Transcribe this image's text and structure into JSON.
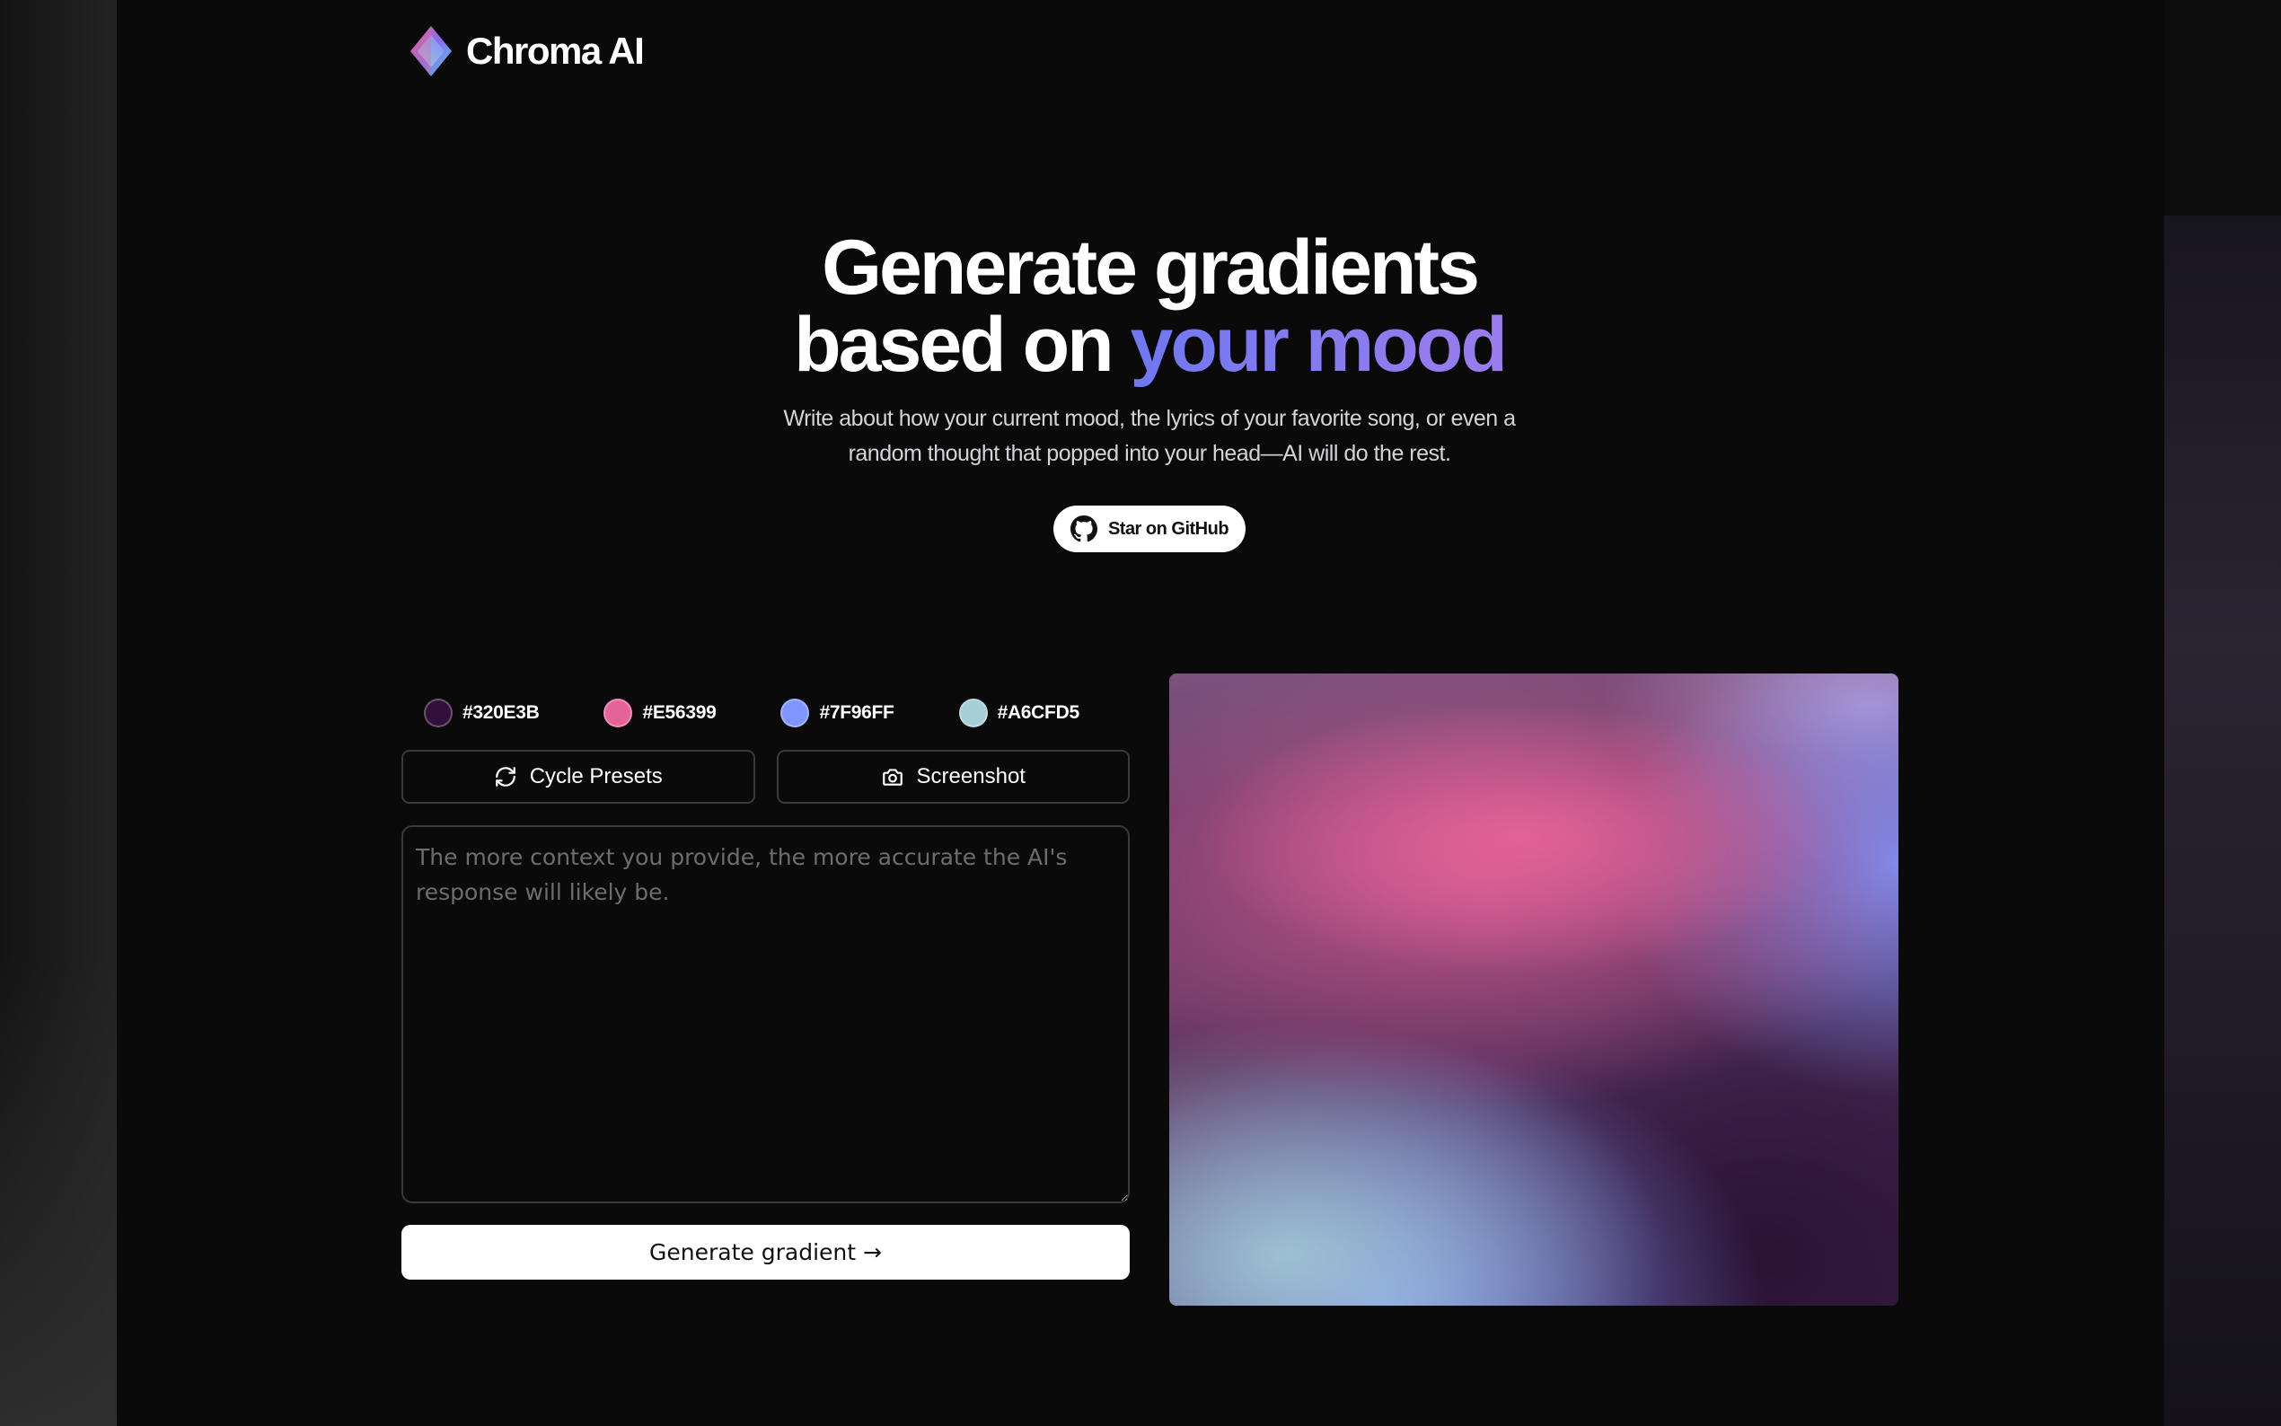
{
  "brand": {
    "name": "Chroma AI",
    "logo_icon": "diamond-logo-icon"
  },
  "hero": {
    "title_line1": "Generate gradients",
    "title_line2_prefix": "based on ",
    "title_line2_accent": "your mood",
    "subtitle": "Write about how your current mood, the lyrics of your favorite song, or even a random thought that popped into your head—AI will do the rest.",
    "github_label": "Star on GitHub",
    "github_icon": "github-icon"
  },
  "palette": [
    {
      "hex": "#320E3B",
      "color": "#320E3B"
    },
    {
      "hex": "#E56399",
      "color": "#E56399"
    },
    {
      "hex": "#7F96FF",
      "color": "#7F96FF"
    },
    {
      "hex": "#A6CFD5",
      "color": "#A6CFD5"
    }
  ],
  "actions": {
    "cycle_label": "Cycle Presets",
    "cycle_icon": "refresh-icon",
    "screenshot_label": "Screenshot",
    "screenshot_icon": "camera-icon"
  },
  "prompt": {
    "placeholder": "The more context you provide, the more accurate the AI's response will likely be.",
    "value": ""
  },
  "generate": {
    "label": "Generate gradient →"
  }
}
